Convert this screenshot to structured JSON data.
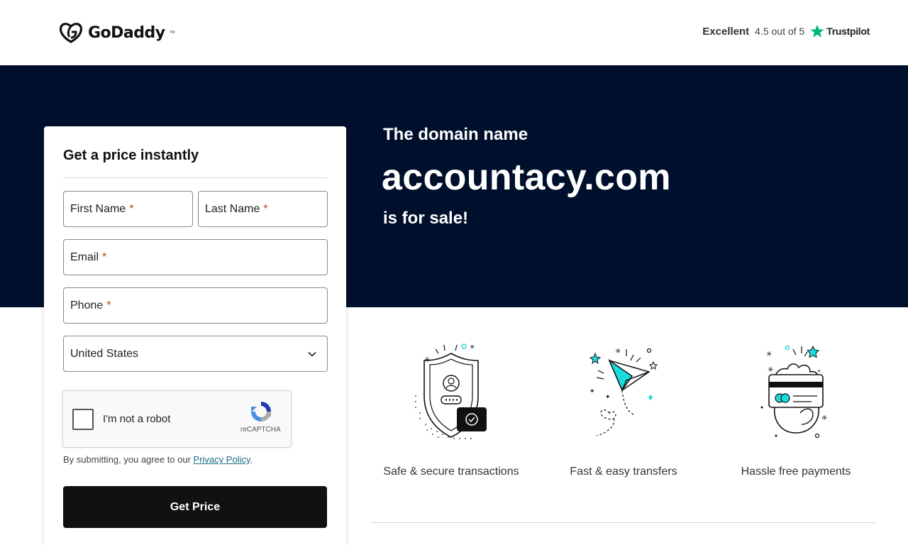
{
  "header": {
    "brand": "GoDaddy",
    "rating_word": "Excellent",
    "rating_score": "4.5 out of 5",
    "trustpilot": "Trustpilot"
  },
  "hero": {
    "pre": "The domain name",
    "domain": "accountacy.com",
    "post": "is for sale!"
  },
  "form": {
    "title": "Get a price instantly",
    "first_name": "First Name",
    "last_name": "Last Name",
    "email": "Email",
    "phone": "Phone",
    "required_mark": "*",
    "country": "United States",
    "captcha_label": "I'm not a robot",
    "captcha_brand": "reCAPTCHA",
    "consent_prefix": "By submitting, you agree to our ",
    "consent_link": "Privacy Policy",
    "consent_suffix": ".",
    "submit": "Get Price"
  },
  "features": [
    {
      "label": "Safe & secure transactions",
      "icon": "shield-icon"
    },
    {
      "label": "Fast & easy transfers",
      "icon": "paper-plane-icon"
    },
    {
      "label": "Hassle free payments",
      "icon": "card-payment-icon"
    }
  ],
  "colors": {
    "hero_bg": "#000f2c",
    "button_bg": "#111111",
    "accent_teal": "#1bdbdb",
    "trustpilot_green": "#00b67a",
    "required_red": "#d0321f"
  }
}
